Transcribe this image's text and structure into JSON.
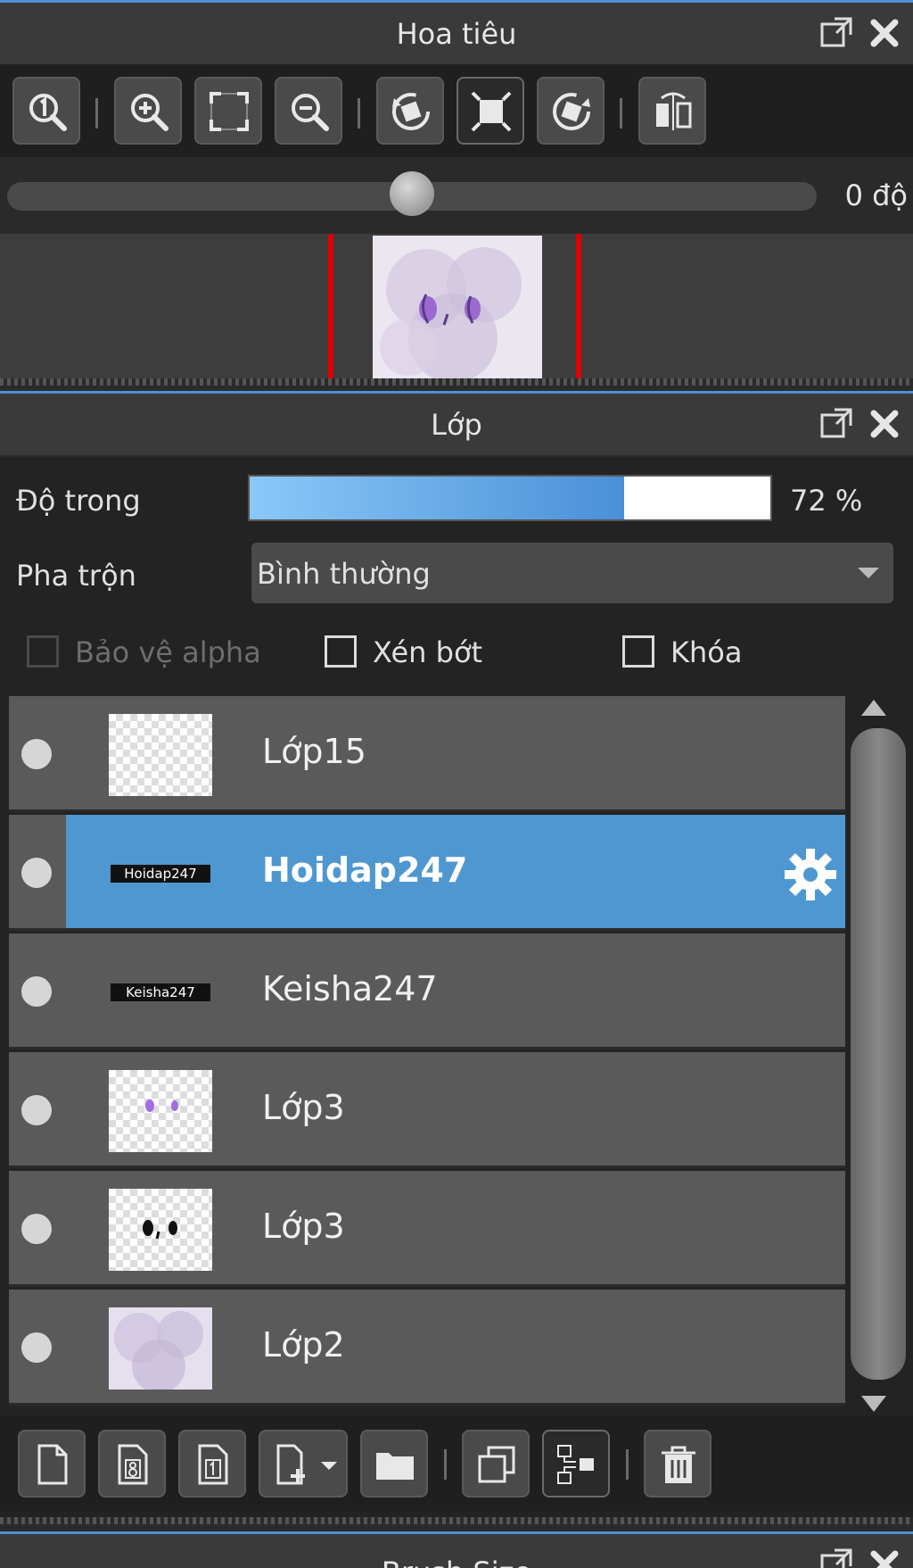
{
  "navigator": {
    "title": "Hoa tiêu",
    "toolbar": [
      {
        "name": "zoom-actual-icon"
      },
      {
        "name": "zoom-in-icon"
      },
      {
        "name": "fit-screen-icon"
      },
      {
        "name": "zoom-out-icon"
      },
      {
        "name": "rotate-left-icon"
      },
      {
        "name": "reset-view-icon"
      },
      {
        "name": "rotate-right-icon"
      },
      {
        "name": "flip-horizontal-icon"
      }
    ],
    "rotation_value": "0 độ",
    "rotation_level": 0.5
  },
  "layers": {
    "title": "Lớp",
    "opacity_label": "Độ trong",
    "opacity_value": "72 %",
    "opacity_fraction": 0.72,
    "blend_label": "Pha trộn",
    "blend_value": "Bình thường",
    "protect_alpha_label": "Bảo vệ alpha",
    "clipping_label": "Xén bớt",
    "lock_label": "Khóa",
    "items": [
      {
        "name": "Lớp15",
        "selected": false
      },
      {
        "name": "Hoidap247",
        "selected": true
      },
      {
        "name": "Keisha247",
        "selected": false
      },
      {
        "name": "Lớp3",
        "selected": false
      },
      {
        "name": "Lớp3",
        "selected": false
      },
      {
        "name": "Lớp2",
        "selected": false
      }
    ],
    "bottom_toolbar": [
      {
        "name": "new-layer-icon"
      },
      {
        "name": "new-8bit-layer-icon"
      },
      {
        "name": "new-1bit-layer-icon"
      },
      {
        "name": "add-layer-dropdown-icon"
      },
      {
        "name": "new-folder-icon"
      },
      {
        "name": "duplicate-layer-icon"
      },
      {
        "name": "merge-layer-icon"
      },
      {
        "name": "delete-layer-icon"
      }
    ]
  },
  "brush_size": {
    "title": "Brush Size"
  },
  "colors": {
    "accent": "#4f97d1",
    "panel_bg": "#232323",
    "row_bg": "#5a5a5a"
  }
}
